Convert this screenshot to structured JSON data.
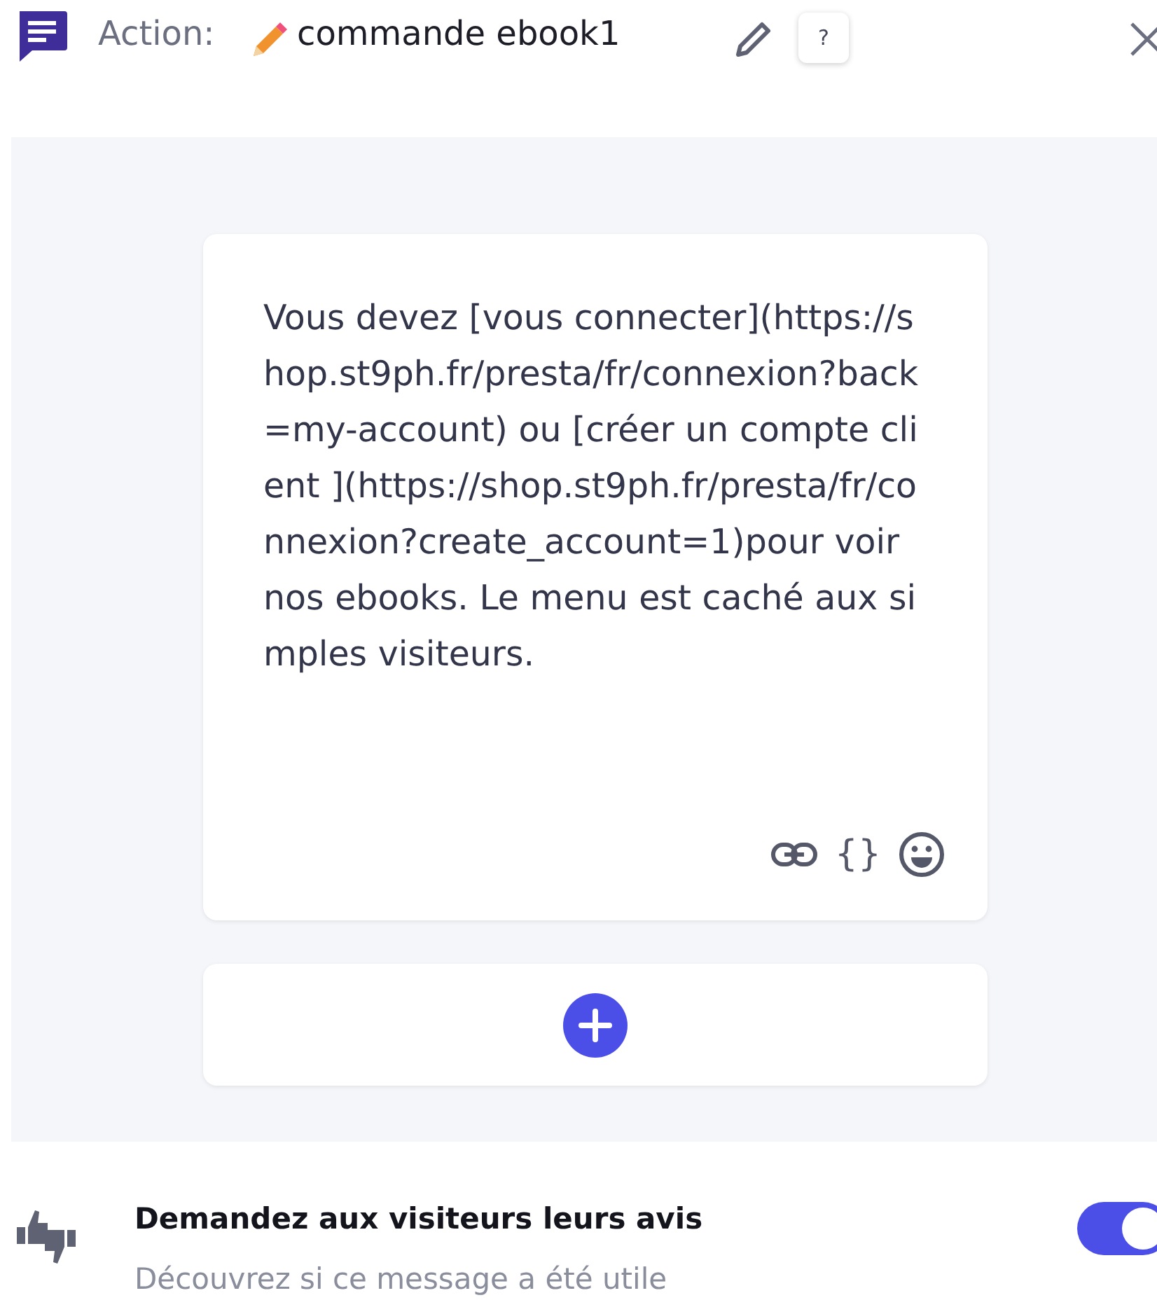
{
  "header": {
    "label": "Action:",
    "name": "commande ebook1",
    "help": "?"
  },
  "message": {
    "text": "Vous devez [vous connecter](https://shop.st9ph.fr/presta/fr/connexion?back=my-account) ou [créer un compte client ](https://shop.st9ph.fr/presta/fr/connexion?create_account=1)pour voir nos ebooks. Le menu est caché aux simples visiteurs.",
    "variable_icon": "{}"
  },
  "feedback": {
    "title": "Demandez aux visiteurs leurs avis",
    "subtitle": "Découvrez si ce message a été utile",
    "on": true
  }
}
